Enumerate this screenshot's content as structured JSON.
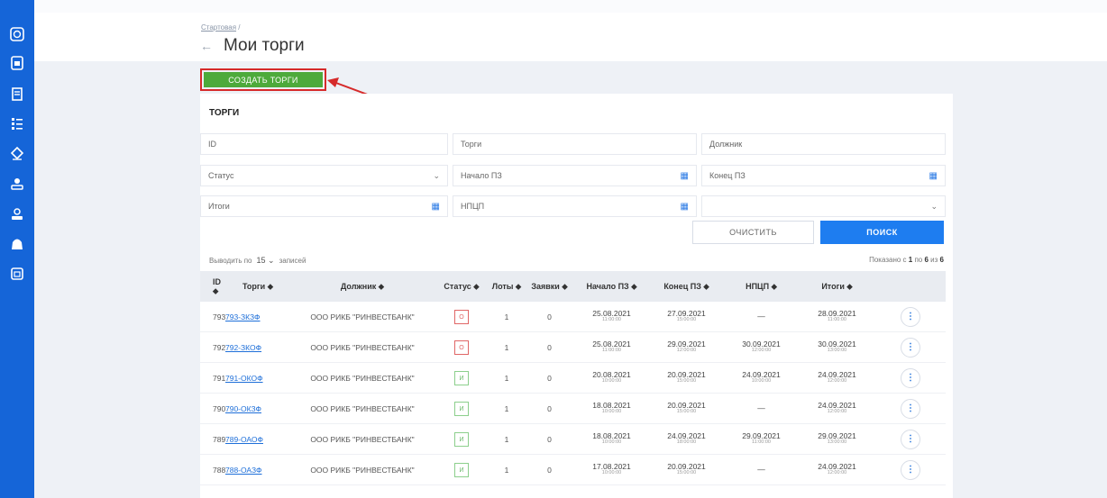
{
  "sidebar": {
    "icons": [
      "globe-icon",
      "document-icon",
      "clipboard-icon",
      "list-icon",
      "gavel-icon",
      "user-check-icon",
      "user-icon",
      "briefcase-icon",
      "calendar-icon"
    ]
  },
  "breadcrumb": {
    "home": "Стартовая",
    "sep": "/"
  },
  "page": {
    "title": "Мои торги",
    "back": "←"
  },
  "create_button": "СОЗДАТЬ ТОРГИ",
  "annotation_color": "#d62a2a",
  "card": {
    "title": "ТОРГИ"
  },
  "filters": {
    "id": "ID",
    "torgi": "Торги",
    "dolzhnik": "Должник",
    "status": "Статус",
    "start": "Начало ПЗ",
    "end": "Конец ПЗ",
    "itogi": "Итоги",
    "npcp": "НПЦП",
    "empty_select": ""
  },
  "buttons": {
    "clear": "ОЧИСТИТЬ",
    "search": "ПОИСК"
  },
  "paging": {
    "prefix": "Выводить по",
    "value": "15",
    "suffix": "записей",
    "shown_prefix": "Показано с",
    "from": "1",
    "mid": "по",
    "to": "6",
    "of": "из",
    "total": "6"
  },
  "table": {
    "headers": {
      "id": "ID ⬥",
      "torgi": "Торги ⬥",
      "dolzhnik": "Должник ⬥",
      "status": "Статус ⬥",
      "lots": "Лоты ⬥",
      "zayavki": "Заявки ⬥",
      "start": "Начало ПЗ ⬥",
      "end": "Конец ПЗ ⬥",
      "npcp": "НПЦП ⬥",
      "itogi": "Итоги ⬥"
    },
    "rows": [
      {
        "id": "793",
        "torgi": "793-ЗКЗФ",
        "dolzhnik": "ООО РИКБ \"РИНВЕСТБАНК\"",
        "status": "О",
        "lots": "1",
        "zayavki": "0",
        "start_d": "25.08.2021",
        "start_t": "11:00:00",
        "end_d": "27.09.2021",
        "end_t": "15:00:00",
        "npcp_d": "—",
        "npcp_t": "",
        "itogi_d": "28.09.2021",
        "itogi_t": "11:00:00"
      },
      {
        "id": "792",
        "torgi": "792-ЗКОФ",
        "dolzhnik": "ООО РИКБ \"РИНВЕСТБАНК\"",
        "status": "О",
        "lots": "1",
        "zayavki": "0",
        "start_d": "25.08.2021",
        "start_t": "11:00:00",
        "end_d": "29.09.2021",
        "end_t": "12:00:00",
        "npcp_d": "30.09.2021",
        "npcp_t": "12:00:00",
        "itogi_d": "30.09.2021",
        "itogi_t": "13:00:00"
      },
      {
        "id": "791",
        "torgi": "791-ОКОФ",
        "dolzhnik": "ООО РИКБ \"РИНВЕСТБАНК\"",
        "status": "И",
        "lots": "1",
        "zayavki": "0",
        "start_d": "20.08.2021",
        "start_t": "10:00:00",
        "end_d": "20.09.2021",
        "end_t": "15:00:00",
        "npcp_d": "24.09.2021",
        "npcp_t": "10:00:00",
        "itogi_d": "24.09.2021",
        "itogi_t": "12:00:00"
      },
      {
        "id": "790",
        "torgi": "790-ОКЗФ",
        "dolzhnik": "ООО РИКБ \"РИНВЕСТБАНК\"",
        "status": "И",
        "lots": "1",
        "zayavki": "0",
        "start_d": "18.08.2021",
        "start_t": "10:00:00",
        "end_d": "20.09.2021",
        "end_t": "15:00:00",
        "npcp_d": "—",
        "npcp_t": "",
        "itogi_d": "24.09.2021",
        "itogi_t": "12:00:00"
      },
      {
        "id": "789",
        "torgi": "789-ОАОФ",
        "dolzhnik": "ООО РИКБ \"РИНВЕСТБАНК\"",
        "status": "И",
        "lots": "1",
        "zayavki": "0",
        "start_d": "18.08.2021",
        "start_t": "10:00:00",
        "end_d": "24.09.2021",
        "end_t": "18:00:00",
        "npcp_d": "29.09.2021",
        "npcp_t": "11:00:00",
        "itogi_d": "29.09.2021",
        "itogi_t": "13:00:00"
      },
      {
        "id": "788",
        "torgi": "788-ОАЗФ",
        "dolzhnik": "ООО РИКБ \"РИНВЕСТБАНК\"",
        "status": "И",
        "lots": "1",
        "zayavki": "0",
        "start_d": "17.08.2021",
        "start_t": "10:00:00",
        "end_d": "20.09.2021",
        "end_t": "15:00:00",
        "npcp_d": "—",
        "npcp_t": "",
        "itogi_d": "24.09.2021",
        "itogi_t": "12:00:00"
      }
    ]
  }
}
